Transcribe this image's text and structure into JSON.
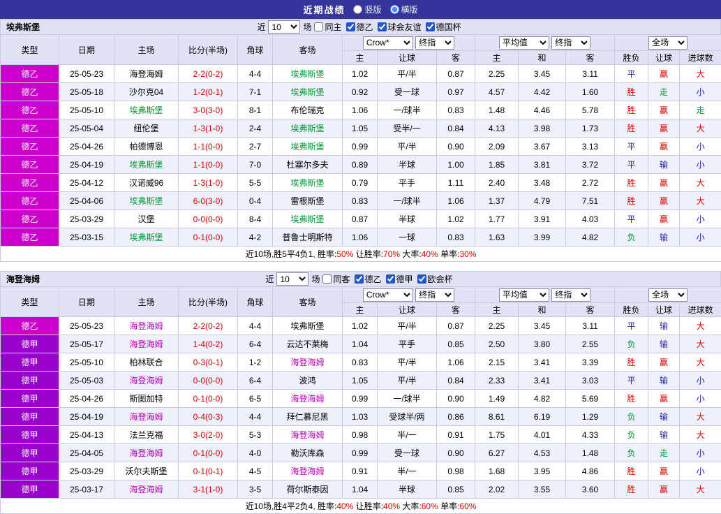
{
  "colors": {
    "topbar_bg": "#34349b",
    "header_bg": "#e2e2f6",
    "row_alt_bg": "#eef0fb",
    "border": "#c9c9e0",
    "league_de2_bg": "#cc00cc",
    "league_de1_bg": "#9900cc",
    "focal_team_table1": "#009933",
    "focal_team_table2": "#c000c0",
    "score_text": "#e00000",
    "win_over_text": "#e00000",
    "draw_under_text": "#2222aa",
    "loss_push_text": "#009933"
  },
  "topbar": {
    "title": "近期战绩",
    "radios": [
      {
        "label": "竖版",
        "checked": false
      },
      {
        "label": "横版",
        "checked": true
      }
    ]
  },
  "tables": [
    {
      "team": "埃弗斯堡",
      "filter": {
        "near_label": "近",
        "count": "10",
        "games_label": "场",
        "checkboxes": [
          {
            "label": "同主",
            "checked": false
          },
          {
            "label": "德乙",
            "checked": true
          },
          {
            "label": "球会友谊",
            "checked": true
          },
          {
            "label": "德国杯",
            "checked": true
          }
        ]
      },
      "header": {
        "cols": [
          "类型",
          "日期",
          "主场",
          "比分(半场)",
          "角球",
          "客场"
        ],
        "odds_select_1": "Crow*",
        "odds_select_2": "终指",
        "avg_select_1": "平均值",
        "avg_select_2": "终指",
        "full_select": "全场",
        "odds_sub": [
          "主",
          "让球",
          "客"
        ],
        "avg_sub": [
          "主",
          "和",
          "客"
        ],
        "result_sub": [
          "胜负",
          "让球",
          "进球数"
        ]
      },
      "rows": [
        {
          "league": "德乙",
          "date": "25-05-23",
          "home": "海登海姆",
          "score": "2-2(0-2)",
          "corner": "4-4",
          "away": "埃弗斯堡",
          "odds_home": "1.02",
          "handicap": "平/半",
          "odds_away": "0.87",
          "avg_home": "2.25",
          "avg_draw": "3.45",
          "avg_away": "3.11",
          "result": "平",
          "handicap_result": "赢",
          "goals_result": "大"
        },
        {
          "league": "德乙",
          "date": "25-05-18",
          "home": "沙尔克04",
          "score": "1-2(0-1)",
          "corner": "7-1",
          "away": "埃弗斯堡",
          "odds_home": "0.92",
          "handicap": "受一球",
          "odds_away": "0.97",
          "avg_home": "4.57",
          "avg_draw": "4.42",
          "avg_away": "1.60",
          "result": "胜",
          "handicap_result": "走",
          "goals_result": "小"
        },
        {
          "league": "德乙",
          "date": "25-05-10",
          "home": "埃弗斯堡",
          "score": "3-0(3-0)",
          "corner": "8-1",
          "away": "布伦瑞克",
          "odds_home": "1.06",
          "handicap": "一/球半",
          "odds_away": "0.83",
          "avg_home": "1.48",
          "avg_draw": "4.46",
          "avg_away": "5.78",
          "result": "胜",
          "handicap_result": "赢",
          "goals_result": "走"
        },
        {
          "league": "德乙",
          "date": "25-05-04",
          "home": "纽伦堡",
          "score": "1-3(1-0)",
          "corner": "2-4",
          "away": "埃弗斯堡",
          "odds_home": "1.05",
          "handicap": "受半/一",
          "odds_away": "0.84",
          "avg_home": "4.13",
          "avg_draw": "3.98",
          "avg_away": "1.73",
          "result": "胜",
          "handicap_result": "赢",
          "goals_result": "大"
        },
        {
          "league": "德乙",
          "date": "25-04-26",
          "home": "帕德博恩",
          "score": "1-1(0-0)",
          "corner": "2-7",
          "away": "埃弗斯堡",
          "odds_home": "0.99",
          "handicap": "平/半",
          "odds_away": "0.90",
          "avg_home": "2.09",
          "avg_draw": "3.67",
          "avg_away": "3.13",
          "result": "平",
          "handicap_result": "赢",
          "goals_result": "小"
        },
        {
          "league": "德乙",
          "date": "25-04-19",
          "home": "埃弗斯堡",
          "score": "1-1(0-0)",
          "corner": "7-0",
          "away": "杜塞尔多夫",
          "odds_home": "0.89",
          "handicap": "半球",
          "odds_away": "1.00",
          "avg_home": "1.85",
          "avg_draw": "3.81",
          "avg_away": "3.72",
          "result": "平",
          "handicap_result": "输",
          "goals_result": "小"
        },
        {
          "league": "德乙",
          "date": "25-04-12",
          "home": "汉诺威96",
          "score": "1-3(1-0)",
          "corner": "5-5",
          "away": "埃弗斯堡",
          "odds_home": "0.79",
          "handicap": "平手",
          "odds_away": "1.11",
          "avg_home": "2.40",
          "avg_draw": "3.48",
          "avg_away": "2.72",
          "result": "胜",
          "handicap_result": "赢",
          "goals_result": "大"
        },
        {
          "league": "德乙",
          "date": "25-04-06",
          "home": "埃弗斯堡",
          "score": "6-0(3-0)",
          "corner": "0-4",
          "away": "雷根斯堡",
          "odds_home": "0.83",
          "handicap": "一/球半",
          "odds_away": "1.06",
          "avg_home": "1.37",
          "avg_draw": "4.79",
          "avg_away": "7.51",
          "result": "胜",
          "handicap_result": "赢",
          "goals_result": "大"
        },
        {
          "league": "德乙",
          "date": "25-03-29",
          "home": "汉堡",
          "score": "0-0(0-0)",
          "corner": "8-4",
          "away": "埃弗斯堡",
          "odds_home": "0.87",
          "handicap": "半球",
          "odds_away": "1.02",
          "avg_home": "1.77",
          "avg_draw": "3.91",
          "avg_away": "4.03",
          "result": "平",
          "handicap_result": "赢",
          "goals_result": "小"
        },
        {
          "league": "德乙",
          "date": "25-03-15",
          "home": "埃弗斯堡",
          "score": "0-1(0-0)",
          "corner": "4-2",
          "away": "普鲁士明斯特",
          "odds_home": "1.06",
          "handicap": "一球",
          "odds_away": "0.83",
          "avg_home": "1.63",
          "avg_draw": "3.99",
          "avg_away": "4.82",
          "result": "负",
          "handicap_result": "输",
          "goals_result": "小"
        }
      ],
      "summary": [
        {
          "text": "近10场,胜5平4负1, 胜率:",
          "highlight": false
        },
        {
          "text": "50%",
          "highlight": true
        },
        {
          "text": " 让胜率:",
          "highlight": false
        },
        {
          "text": "70%",
          "highlight": true
        },
        {
          "text": " 大率:",
          "highlight": false
        },
        {
          "text": "40%",
          "highlight": true
        },
        {
          "text": " 单率:",
          "highlight": false
        },
        {
          "text": "30%",
          "highlight": true
        }
      ]
    },
    {
      "team": "海登海姆",
      "filter": {
        "near_label": "近",
        "count": "10",
        "games_label": "场",
        "checkboxes": [
          {
            "label": "同客",
            "checked": false
          },
          {
            "label": "德乙",
            "checked": true
          },
          {
            "label": "德甲",
            "checked": true
          },
          {
            "label": "欧会杯",
            "checked": true
          }
        ]
      },
      "header": {
        "cols": [
          "类型",
          "日期",
          "主场",
          "比分(半场)",
          "角球",
          "客场"
        ],
        "odds_select_1": "Crow*",
        "odds_select_2": "终指",
        "avg_select_1": "平均值",
        "avg_select_2": "终指",
        "full_select": "全场",
        "odds_sub": [
          "主",
          "让球",
          "客"
        ],
        "avg_sub": [
          "主",
          "和",
          "客"
        ],
        "result_sub": [
          "胜负",
          "让球",
          "进球数"
        ]
      },
      "rows": [
        {
          "league": "德乙",
          "date": "25-05-23",
          "home": "海登海姆",
          "score": "2-2(0-2)",
          "corner": "4-4",
          "away": "埃弗斯堡",
          "odds_home": "1.02",
          "handicap": "平/半",
          "odds_away": "0.87",
          "avg_home": "2.25",
          "avg_draw": "3.45",
          "avg_away": "3.11",
          "result": "平",
          "handicap_result": "输",
          "goals_result": "大"
        },
        {
          "league": "德甲",
          "date": "25-05-17",
          "home": "海登海姆",
          "score": "1-4(0-2)",
          "corner": "6-4",
          "away": "云达不莱梅",
          "odds_home": "1.04",
          "handicap": "平手",
          "odds_away": "0.85",
          "avg_home": "2.50",
          "avg_draw": "3.80",
          "avg_away": "2.55",
          "result": "负",
          "handicap_result": "输",
          "goals_result": "大"
        },
        {
          "league": "德甲",
          "date": "25-05-10",
          "home": "柏林联合",
          "score": "0-3(0-1)",
          "corner": "1-2",
          "away": "海登海姆",
          "odds_home": "0.83",
          "handicap": "平/半",
          "odds_away": "1.06",
          "avg_home": "2.15",
          "avg_draw": "3.41",
          "avg_away": "3.39",
          "result": "胜",
          "handicap_result": "赢",
          "goals_result": "大"
        },
        {
          "league": "德甲",
          "date": "25-05-03",
          "home": "海登海姆",
          "score": "0-0(0-0)",
          "corner": "6-4",
          "away": "波鸿",
          "odds_home": "1.05",
          "handicap": "平/半",
          "odds_away": "0.84",
          "avg_home": "2.33",
          "avg_draw": "3.41",
          "avg_away": "3.03",
          "result": "平",
          "handicap_result": "输",
          "goals_result": "小"
        },
        {
          "league": "德甲",
          "date": "25-04-26",
          "home": "斯图加特",
          "score": "0-1(0-0)",
          "corner": "6-5",
          "away": "海登海姆",
          "odds_home": "0.99",
          "handicap": "一/球半",
          "odds_away": "0.90",
          "avg_home": "1.49",
          "avg_draw": "4.82",
          "avg_away": "5.69",
          "result": "胜",
          "handicap_result": "赢",
          "goals_result": "小"
        },
        {
          "league": "德甲",
          "date": "25-04-19",
          "home": "海登海姆",
          "score": "0-4(0-3)",
          "corner": "4-4",
          "away": "拜仁慕尼黑",
          "odds_home": "1.03",
          "handicap": "受球半/两",
          "odds_away": "0.86",
          "avg_home": "8.61",
          "avg_draw": "6.19",
          "avg_away": "1.29",
          "result": "负",
          "handicap_result": "输",
          "goals_result": "大"
        },
        {
          "league": "德甲",
          "date": "25-04-13",
          "home": "法兰克福",
          "score": "3-0(2-0)",
          "corner": "5-3",
          "away": "海登海姆",
          "odds_home": "0.98",
          "handicap": "半/一",
          "odds_away": "0.91",
          "avg_home": "1.75",
          "avg_draw": "4.01",
          "avg_away": "4.33",
          "result": "负",
          "handicap_result": "输",
          "goals_result": "大"
        },
        {
          "league": "德甲",
          "date": "25-04-05",
          "home": "海登海姆",
          "score": "0-1(0-0)",
          "corner": "4-0",
          "away": "勒沃库森",
          "odds_home": "0.99",
          "handicap": "受一球",
          "odds_away": "0.90",
          "avg_home": "6.27",
          "avg_draw": "4.53",
          "avg_away": "1.48",
          "result": "负",
          "handicap_result": "走",
          "goals_result": "小"
        },
        {
          "league": "德甲",
          "date": "25-03-29",
          "home": "沃尔夫斯堡",
          "score": "0-1(0-1)",
          "corner": "4-5",
          "away": "海登海姆",
          "odds_home": "0.91",
          "handicap": "半/一",
          "odds_away": "0.98",
          "avg_home": "1.68",
          "avg_draw": "3.95",
          "avg_away": "4.86",
          "result": "胜",
          "handicap_result": "赢",
          "goals_result": "小"
        },
        {
          "league": "德甲",
          "date": "25-03-17",
          "home": "海登海姆",
          "score": "3-1(1-0)",
          "corner": "3-5",
          "away": "荷尔斯泰因",
          "odds_home": "1.04",
          "handicap": "半球",
          "odds_away": "0.85",
          "avg_home": "2.02",
          "avg_draw": "3.55",
          "avg_away": "3.60",
          "result": "胜",
          "handicap_result": "赢",
          "goals_result": "大"
        }
      ],
      "summary": [
        {
          "text": "近10场,胜4平2负4, 胜率:",
          "highlight": false
        },
        {
          "text": "40%",
          "highlight": true
        },
        {
          "text": " 让胜率:",
          "highlight": false
        },
        {
          "text": "40%",
          "highlight": true
        },
        {
          "text": " 大率:",
          "highlight": false
        },
        {
          "text": "60%",
          "highlight": true
        },
        {
          "text": " 单率:",
          "highlight": false
        },
        {
          "text": "60%",
          "highlight": true
        }
      ]
    }
  ]
}
